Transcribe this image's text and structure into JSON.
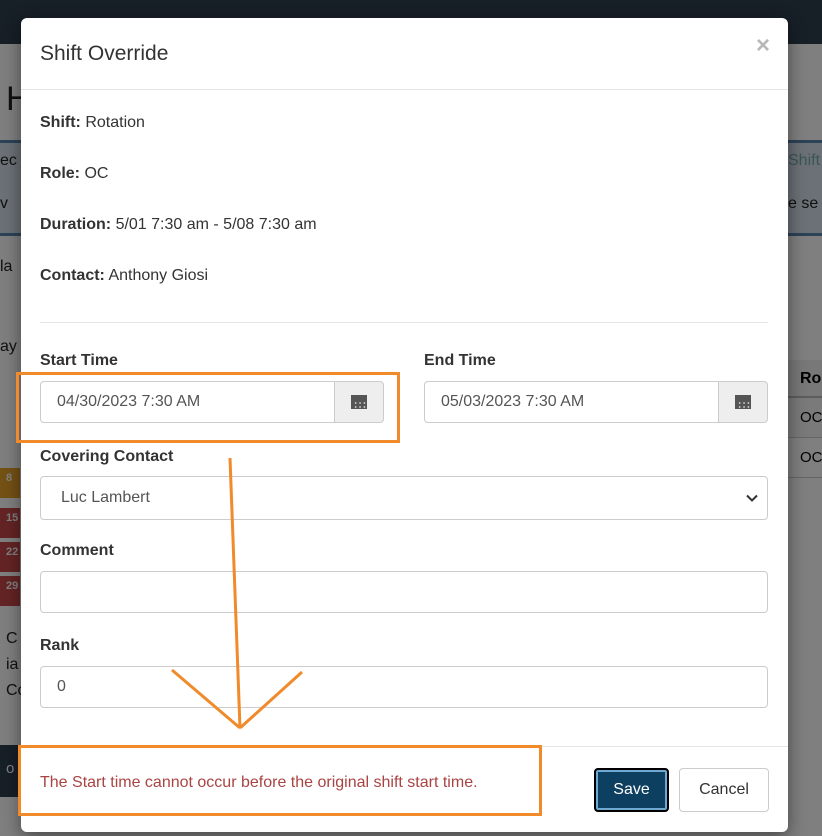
{
  "background": {
    "fragments": [
      "H",
      "ec",
      "v",
      "Shift",
      "e se",
      "la",
      "ay",
      "C",
      "ia",
      "Co",
      "o"
    ],
    "table": {
      "header": "Ro",
      "rows": [
        "OC",
        "OC"
      ]
    },
    "calendar_numbers": [
      "8",
      "15",
      "22",
      "29"
    ]
  },
  "modal": {
    "title": "Shift Override",
    "close": "×",
    "info": [
      {
        "label": "Shift:",
        "value": "Rotation"
      },
      {
        "label": "Role:",
        "value": "OC"
      },
      {
        "label": "Duration:",
        "value": "5/01 7:30 am - 5/08 7:30 am"
      },
      {
        "label": "Contact:",
        "value": "Anthony Giosi"
      }
    ],
    "start_time": {
      "label": "Start Time",
      "value": "04/30/2023 7:30 AM"
    },
    "end_time": {
      "label": "End Time",
      "value": "05/03/2023 7:30 AM"
    },
    "covering_contact": {
      "label": "Covering Contact",
      "value": "Luc Lambert"
    },
    "comment": {
      "label": "Comment",
      "value": ""
    },
    "rank": {
      "label": "Rank",
      "value": "0"
    },
    "error": "The Start time cannot occur before the original shift start time.",
    "save_label": "Save",
    "cancel_label": "Cancel"
  },
  "colors": {
    "annotation": "#f08a2a",
    "error": "#a94442",
    "primary_button": "#0d3f60"
  }
}
